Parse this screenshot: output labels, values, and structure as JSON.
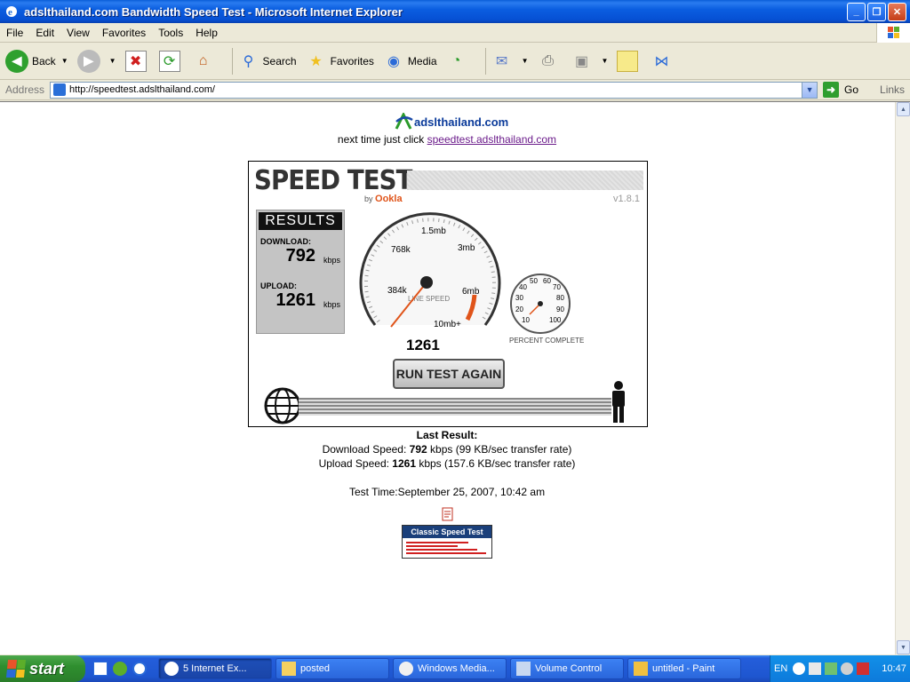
{
  "window": {
    "title": "adslthailand.com Bandwidth Speed Test - Microsoft Internet Explorer",
    "minimize": "_",
    "maximize": "❐",
    "close": "✕"
  },
  "menu": [
    "File",
    "Edit",
    "View",
    "Favorites",
    "Tools",
    "Help"
  ],
  "toolbar": {
    "back": "Back",
    "search": "Search",
    "favorites": "Favorites",
    "media": "Media"
  },
  "address": {
    "label": "Address",
    "url": "http://speedtest.adslthailand.com/",
    "go": "Go",
    "links": "Links"
  },
  "page": {
    "logo_text": "adslthailand.com",
    "next_time_prefix": "next time just click ",
    "next_time_link": "speedtest.adslthailand.com",
    "speedtest": {
      "title": "SPEED TEST",
      "by": "by",
      "brand": "Ookla",
      "version": "v1.8.1",
      "results_header": "RESULTS",
      "download_label": "DOWNLOAD:",
      "download_value": "792",
      "upload_label": "UPLOAD:",
      "upload_value": "1261",
      "unit": "kbps",
      "gauge_labels": [
        "384k",
        "768k",
        "1.5mb",
        "3mb",
        "6mb",
        "10mb+"
      ],
      "gauge_center_label": "LINE SPEED",
      "gauge_reading": "1261",
      "percent_labels": [
        "10",
        "20",
        "30",
        "40",
        "50",
        "60",
        "70",
        "80",
        "90",
        "100"
      ],
      "percent_label": "PERCENT COMPLETE",
      "run_button": "RUN TEST AGAIN"
    },
    "last_result": {
      "heading": "Last Result:",
      "download_prefix": "Download Speed: ",
      "download_value": "792",
      "download_suffix": " kbps (99 KB/sec transfer rate)",
      "upload_prefix": "Upload Speed: ",
      "upload_value": "1261",
      "upload_suffix": " kbps (157.6 KB/sec transfer rate)"
    },
    "test_time": "Test Time:September 25, 2007, 10:42 am",
    "classic_label": "Classic Speed Test"
  },
  "taskbar": {
    "start": "start",
    "tasks": [
      {
        "label": "5 Internet Ex...",
        "active": true
      },
      {
        "label": "posted",
        "active": false
      },
      {
        "label": "Windows Media...",
        "active": false
      },
      {
        "label": "Volume Control",
        "active": false
      },
      {
        "label": "untitled - Paint",
        "active": false
      }
    ],
    "lang": "EN",
    "clock": "10:47"
  },
  "colors": {
    "title_blue": "#0650d4",
    "taskbar_blue": "#245edb",
    "start_green": "#2f8f2f",
    "ookla_orange": "#e0541a",
    "link_purple": "#6a1a8a"
  }
}
